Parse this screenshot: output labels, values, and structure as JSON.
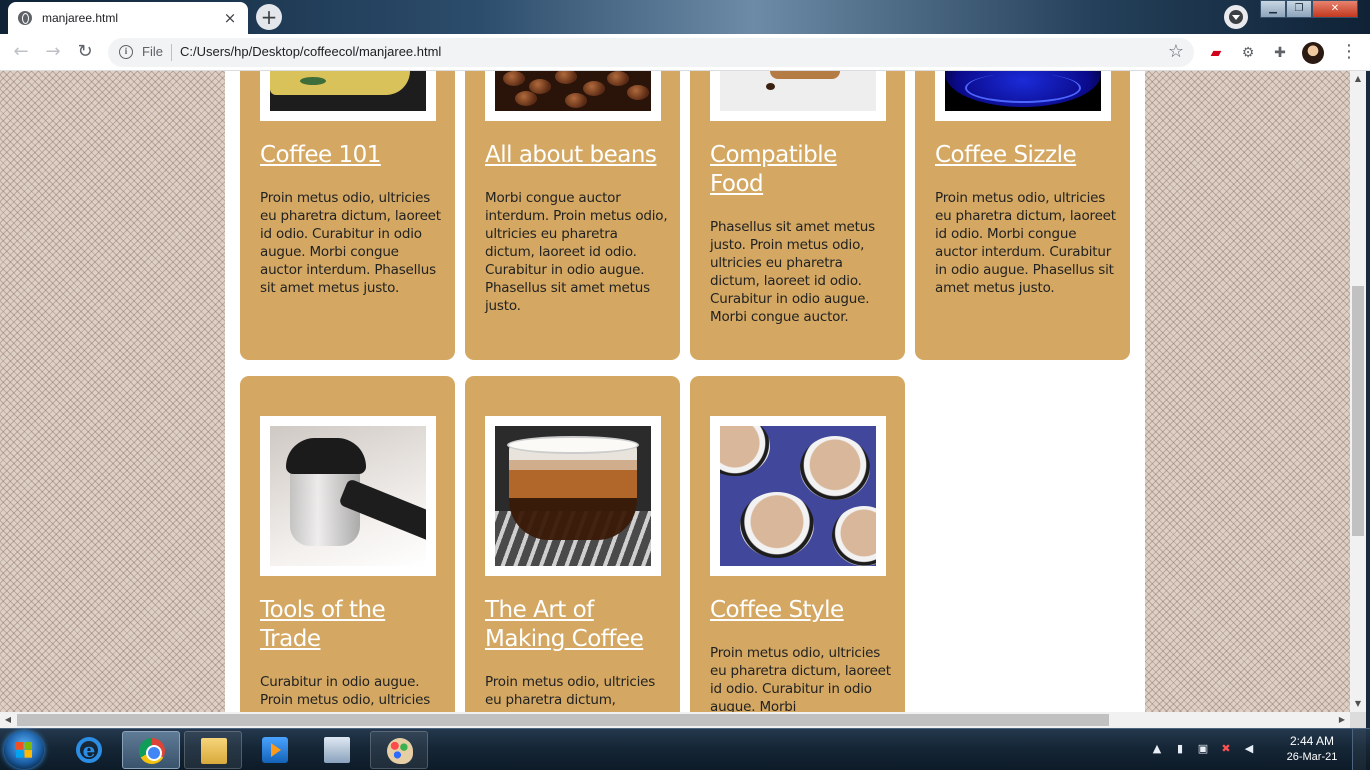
{
  "browser": {
    "tab_title": "manjaree.html",
    "tab_close": "×",
    "new_tab": "+",
    "scheme_label": "File",
    "url": "C:/Users/hp/Desktop/coffeecol/manjaree.html",
    "back": "←",
    "forward": "→",
    "reload": "↻",
    "bookmark": "☆",
    "menu": "⋮",
    "window_minimize": "▁",
    "window_restore": "❐",
    "window_close": "✕"
  },
  "cards": [
    {
      "title": "Coffee 101",
      "text": "Proin metus odio, ultricies eu pharetra dictum, laoreet id odio. Curabitur in odio augue. Morbi congue auctor interdum. Phasellus sit amet metus justo.",
      "image": "coffee-cup"
    },
    {
      "title": "All about beans",
      "text": "Morbi congue auctor interdum. Proin metus odio, ultricies eu pharetra dictum, laoreet id odio. Curabitur in odio augue. Phasellus sit amet metus justo.",
      "image": "coffee-beans"
    },
    {
      "title": "Compatible Food",
      "text": "Phasellus sit amet metus justo. Proin metus odio, ultricies eu pharetra dictum, laoreet id odio. Curabitur in odio augue. Morbi congue auctor.",
      "image": "cookie"
    },
    {
      "title": "Coffee Sizzle",
      "text": "Proin metus odio, ultricies eu pharetra dictum, laoreet id odio. Morbi congue auctor interdum. Curabitur in odio augue. Phasellus sit amet metus justo.",
      "image": "blue-cup"
    },
    {
      "title": "Tools of the Trade",
      "text": "Curabitur in odio augue. Proin metus odio, ultricies",
      "image": "coffee-pot"
    },
    {
      "title": "The Art of Making Coffee",
      "text": "Proin metus odio, ultricies eu pharetra dictum,",
      "image": "espresso-glass"
    },
    {
      "title": "Coffee Style",
      "text": "Proin metus odio, ultricies eu pharetra dictum, laoreet id odio. Curabitur in odio augue. Morbi",
      "image": "striped-cups"
    }
  ],
  "taskbar": {
    "time": "2:44 AM",
    "date": "26-Mar-21",
    "apps": [
      "internet-explorer",
      "chrome",
      "file-explorer",
      "media-player",
      "remote-desktop",
      "paint"
    ]
  },
  "colors": {
    "card": "#d4a862",
    "page_bg": "#ffffff",
    "title_link": "#ffffff"
  }
}
